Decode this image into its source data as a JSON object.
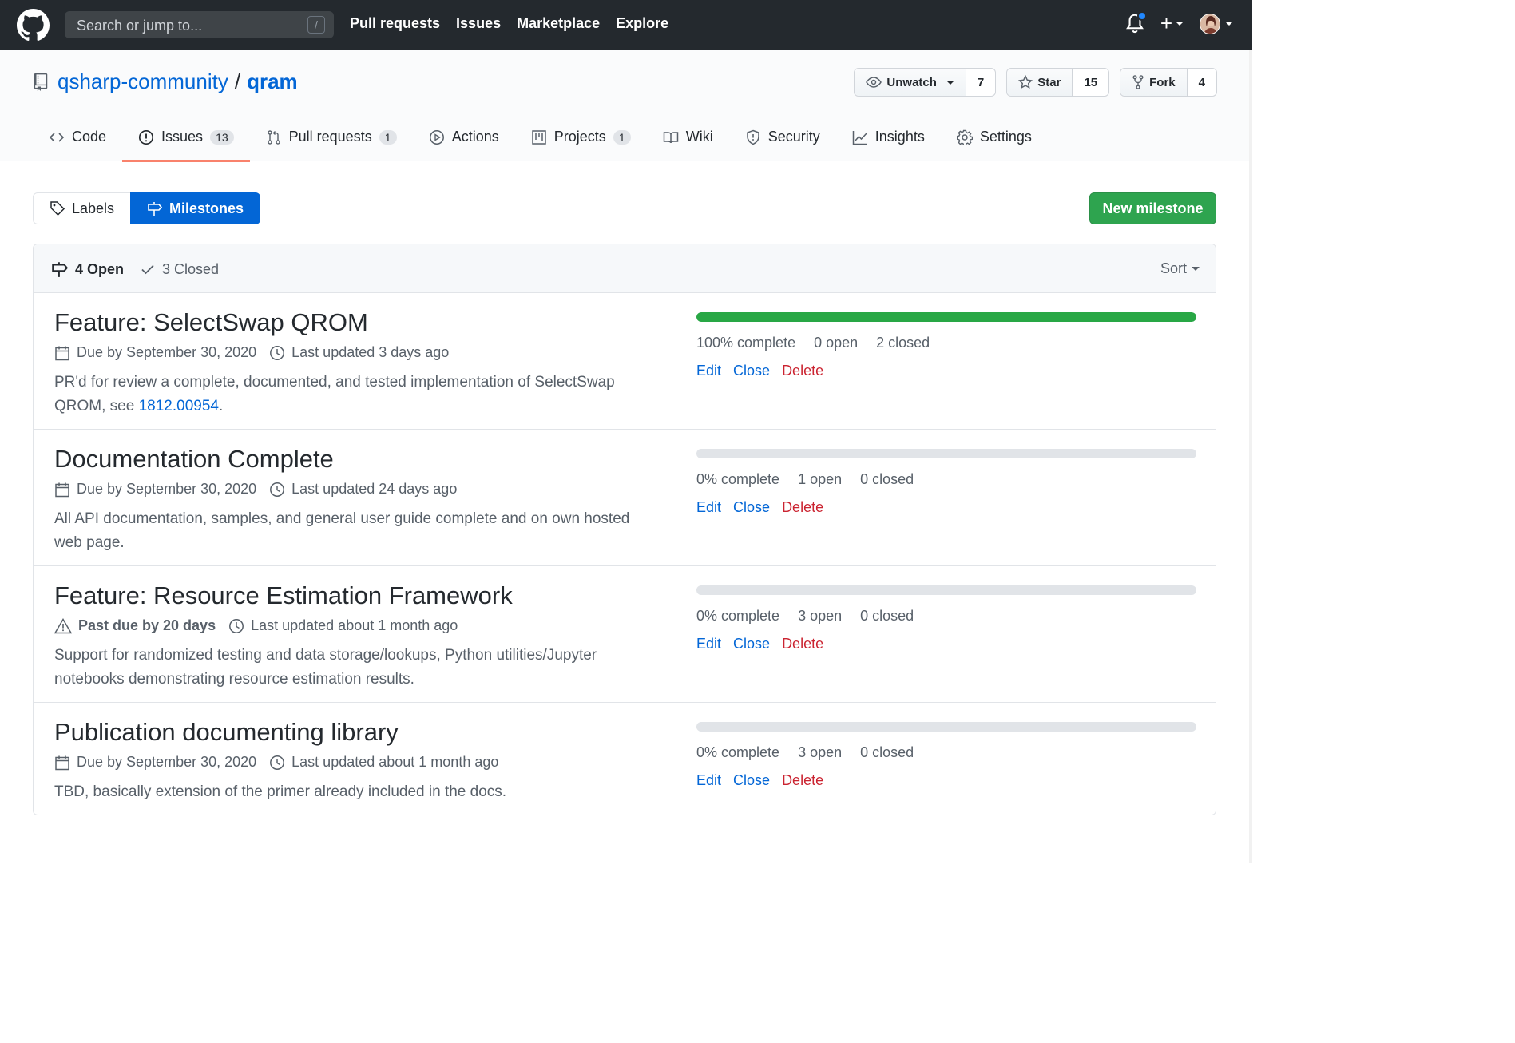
{
  "header": {
    "search_placeholder": "Search or jump to...",
    "search_shortcut": "/",
    "nav": [
      "Pull requests",
      "Issues",
      "Marketplace",
      "Explore"
    ],
    "plus_label": "+"
  },
  "repo": {
    "owner": "qsharp-community",
    "separator": "/",
    "name": "qram",
    "watch_label": "Unwatch",
    "watch_count": "7",
    "star_label": "Star",
    "star_count": "15",
    "fork_label": "Fork",
    "fork_count": "4"
  },
  "reponav": [
    {
      "label": "Code",
      "counter": "",
      "icon": "code-icon"
    },
    {
      "label": "Issues",
      "counter": "13",
      "icon": "issue-icon"
    },
    {
      "label": "Pull requests",
      "counter": "1",
      "icon": "pull-request-icon"
    },
    {
      "label": "Actions",
      "counter": "",
      "icon": "play-icon"
    },
    {
      "label": "Projects",
      "counter": "1",
      "icon": "project-icon"
    },
    {
      "label": "Wiki",
      "counter": "",
      "icon": "book-icon"
    },
    {
      "label": "Security",
      "counter": "",
      "icon": "shield-icon"
    },
    {
      "label": "Insights",
      "counter": "",
      "icon": "graph-icon"
    },
    {
      "label": "Settings",
      "counter": "",
      "icon": "gear-icon"
    }
  ],
  "subnav": {
    "labels": "Labels",
    "milestones": "Milestones",
    "new_milestone": "New milestone"
  },
  "states": {
    "open": "4 Open",
    "closed": "3 Closed",
    "sort": "Sort"
  },
  "milestones": [
    {
      "title": "Feature: SelectSwap QROM",
      "due": "Due by September 30, 2020",
      "updated": "Last updated 3 days ago",
      "desc": "PR'd for review a complete, documented, and tested implementation of SelectSwap QROM, see ",
      "desc_link": "1812.00954",
      "desc_end": ".",
      "progress": 1.0,
      "complete": "100% complete",
      "open": "0 open",
      "closed": "2 closed"
    },
    {
      "title": "Documentation Complete",
      "due": "Due by September 30, 2020",
      "updated": "Last updated 24 days ago",
      "desc": "All API documentation, samples, and general user guide complete and on own hosted web page.",
      "progress": 0.0,
      "complete": "0% complete",
      "open": "1 open",
      "closed": "0 closed"
    },
    {
      "title": "Feature: Resource Estimation Framework",
      "due": "Past due by 20 days",
      "updated": "Last updated about 1 month ago",
      "desc": "Support for randomized testing and data storage/lookups, Python utilities/Jupyter notebooks demonstrating resource estimation results.",
      "progress": 0.0,
      "complete": "0% complete",
      "open": "3 open",
      "closed": "0 closed"
    },
    {
      "title": "Publication documenting library",
      "due": "Due by September 30, 2020",
      "updated": "Last updated about 1 month ago",
      "desc": "TBD, basically extension of the primer already included in the docs.",
      "progress": 0.0,
      "complete": "0% complete",
      "open": "3 open",
      "closed": "0 closed"
    }
  ],
  "actions": {
    "edit": "Edit",
    "close": "Close",
    "delete": "Delete"
  },
  "colors": {
    "header_bg": "#24292e",
    "link": "#0366d6",
    "primary_green": "#2ea44f",
    "progress_green": "#28a745",
    "danger": "#cb2431",
    "tab_underline": "#f9826c"
  }
}
